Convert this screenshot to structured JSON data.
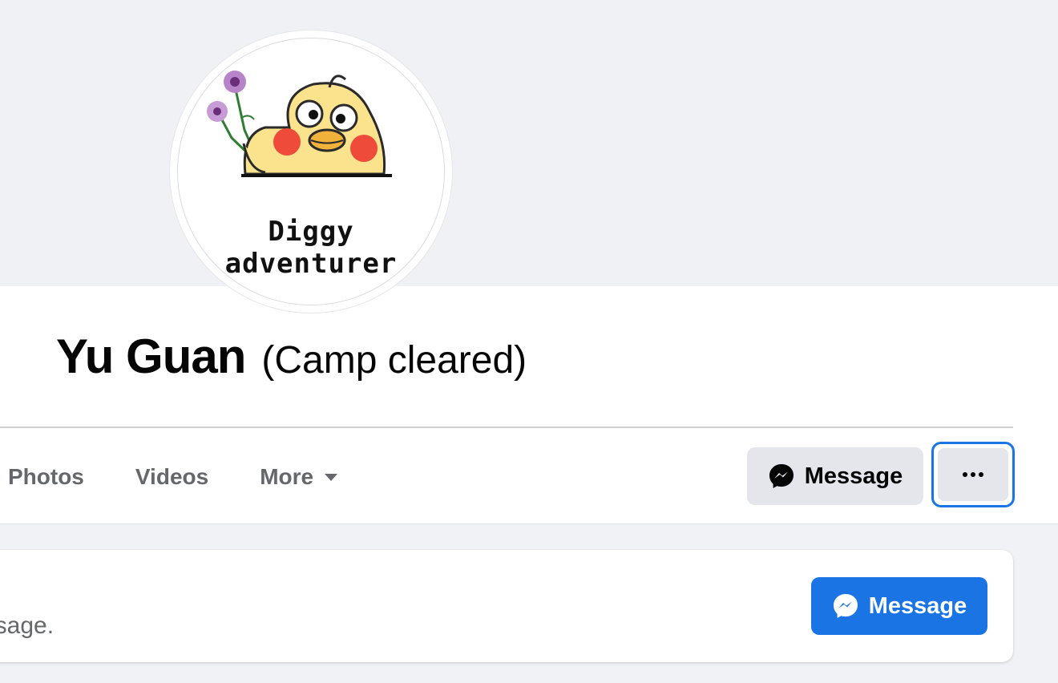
{
  "profile": {
    "name": "Yu Guan",
    "tagline": "(Camp cleared)",
    "avatar_caption_line1": "Diggy",
    "avatar_caption_line2": "adventurer"
  },
  "nav": {
    "tabs": [
      {
        "label": "Photos"
      },
      {
        "label": "Videos"
      },
      {
        "label": "More"
      }
    ]
  },
  "actions": {
    "message_label": "Message",
    "more_icon": "more-horizontal-icon"
  },
  "card": {
    "text": "Send a message.",
    "visible_text": "essage.",
    "button_label": "Message"
  },
  "colors": {
    "accent": "#1b74e4",
    "secondary_button": "#e4e6eb",
    "text_secondary": "#65676b"
  },
  "icons": {
    "messenger": "messenger-icon",
    "caret": "caret-down-icon"
  }
}
